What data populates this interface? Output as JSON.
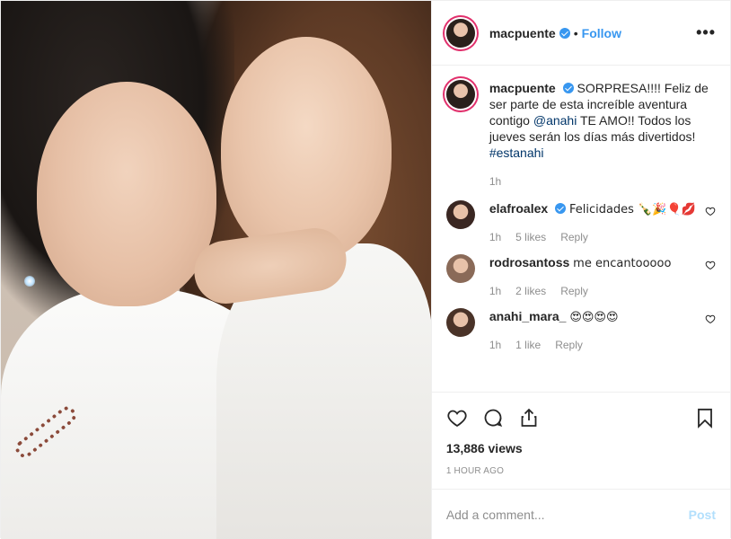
{
  "post": {
    "author": "macpuente",
    "follow_label": "Follow",
    "dot": "•",
    "more_label": "•••",
    "caption": {
      "user": "macpuente",
      "text_before": "SORPRESA!!!! Feliz de ser parte de esta increíble aventura contigo ",
      "mention": "@anahi",
      "text_after": " TE AMO!! Todos los jueves serán los días más divertidos! ",
      "hashtag": "#estanahi",
      "time": "1h"
    },
    "comments": [
      {
        "user": "elafroalex",
        "verified": true,
        "text": "Felicidades 🍾🎉🎈💋",
        "time": "1h",
        "likes": "5 likes",
        "reply": "Reply",
        "avatar_color": "#3a2722"
      },
      {
        "user": "rodrosantoss",
        "verified": false,
        "text": "me encantooooo",
        "time": "1h",
        "likes": "2 likes",
        "reply": "Reply",
        "avatar_color": "#8a6a58"
      },
      {
        "user": "anahi_mara_",
        "verified": false,
        "text": "😍😍😍😍",
        "time": "1h",
        "likes": "1 like",
        "reply": "Reply",
        "avatar_color": "#4a3328"
      }
    ],
    "views": "13,886 views",
    "posted_ago": "1 HOUR AGO",
    "add_comment_placeholder": "Add a comment...",
    "post_label": "Post",
    "icons": [
      "heart-icon",
      "comment-icon",
      "share-icon",
      "bookmark-icon"
    ],
    "colors": {
      "link": "#3897f0",
      "verified": "#3897f0",
      "muted": "#8e8e8e",
      "post_disabled": "#b2dffc"
    }
  }
}
